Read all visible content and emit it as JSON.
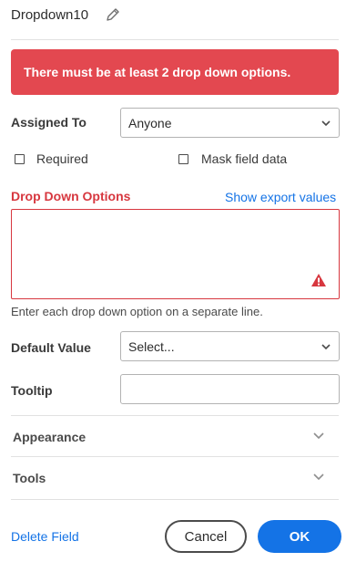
{
  "header": {
    "title": "Dropdown10",
    "edit_icon": "pencil-icon"
  },
  "error": {
    "message": "There must be at least 2 drop down options."
  },
  "assigned_to": {
    "label": "Assigned To",
    "value": "Anyone"
  },
  "checkboxes": {
    "required_label": "Required",
    "mask_label": "Mask field data",
    "required_checked": false,
    "mask_checked": false
  },
  "options": {
    "label": "Drop Down Options",
    "export_link": "Show export values",
    "value": "",
    "helper": "Enter each drop down option on a separate line.",
    "warning_icon": "alert-triangle-icon"
  },
  "default_value": {
    "label": "Default Value",
    "value": "Select..."
  },
  "tooltip": {
    "label": "Tooltip",
    "value": ""
  },
  "sections": {
    "appearance": "Appearance",
    "tools": "Tools"
  },
  "footer": {
    "delete_label": "Delete Field",
    "cancel_label": "Cancel",
    "ok_label": "OK"
  },
  "colors": {
    "error": "#e34850",
    "error_text": "#d7373f",
    "link": "#1473e6",
    "primary": "#1473e6"
  }
}
